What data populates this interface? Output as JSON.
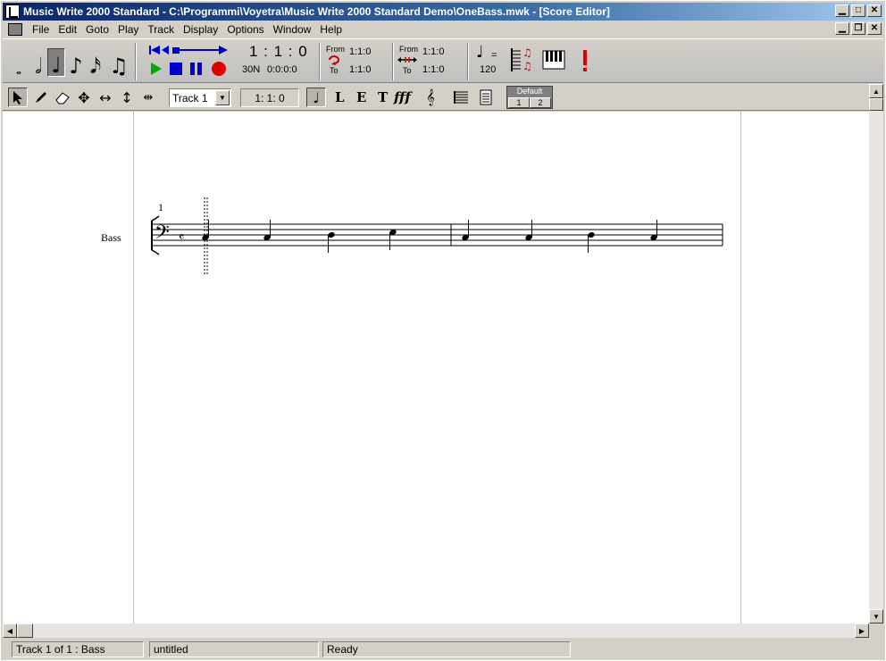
{
  "window": {
    "title": "Music Write 2000 Standard  -  C:\\Programmi\\Voyetra\\Music Write 2000 Standard Demo\\OneBass.mwk - [Score Editor]"
  },
  "menu": [
    "File",
    "Edit",
    "Goto",
    "Play",
    "Track",
    "Display",
    "Options",
    "Window",
    "Help"
  ],
  "transport": {
    "position": "1 : 1 : 0",
    "snap": "30N",
    "time": "0:0:0:0",
    "loop_from_label": "From",
    "loop_from": "1:1:0",
    "loop_to_label": "To",
    "loop_to": "1:1:0",
    "punch_from_label": "From",
    "punch_from": "1:1:0",
    "punch_to_label": "To",
    "punch_to": "1:1:0",
    "tempo_eq": "=",
    "tempo": "120"
  },
  "toolbar2": {
    "track_select": "Track 1",
    "position": "1:  1:  0",
    "letters": [
      "L",
      "E",
      "T",
      "fff"
    ],
    "layout_label": "Default",
    "pages": [
      "1",
      "2"
    ]
  },
  "score": {
    "measure_number": "1",
    "staff_name": "Bass"
  },
  "status": {
    "track": "Track  1 of  1 : Bass",
    "file": "untitled",
    "state": "Ready"
  }
}
